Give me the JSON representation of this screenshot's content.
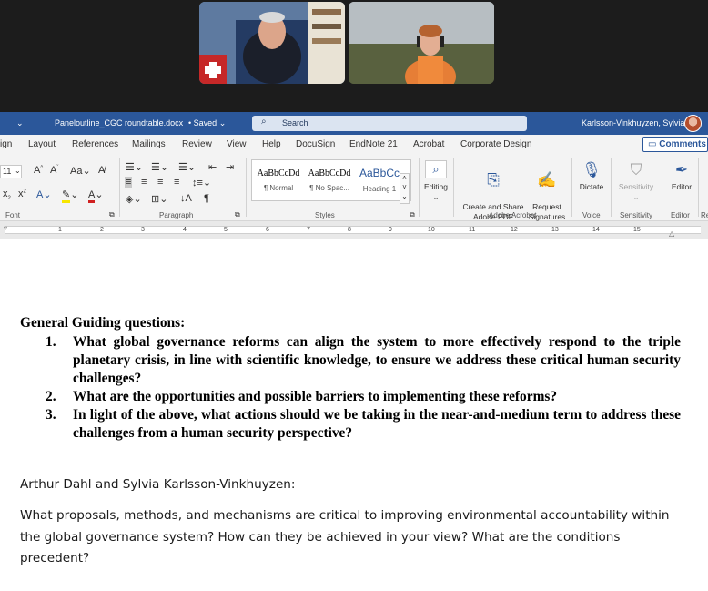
{
  "titlebar": {
    "quick_access_chevron": "⌄",
    "filename": "Paneloutline_CGC roundtable.docx",
    "save_status": "Saved",
    "search_placeholder": "Search",
    "user_name": "Karlsson-Vinkhuyzen, Sylvia"
  },
  "tabs": [
    "ign",
    "Layout",
    "References",
    "Mailings",
    "Review",
    "View",
    "Help",
    "DocuSign",
    "EndNote 21",
    "Acrobat",
    "Corporate Design"
  ],
  "comments_label": "Comments",
  "ribbon": {
    "font_size": "11",
    "font_group": "Font",
    "paragraph_group": "Paragraph",
    "styles_group": "Styles",
    "styles": [
      {
        "sample": "AaBbCcDd",
        "name": "¶ Normal"
      },
      {
        "sample": "AaBbCcDd",
        "name": "¶ No Spac..."
      },
      {
        "sample": "AaBbCc",
        "name": "Heading 1"
      }
    ],
    "editing": "Editing",
    "create_share": "Create and Share\nAdobe PDF",
    "request_signatures": "Request\nSignatures",
    "adobe_acrobat_group": "Adobe Acrobat",
    "dictate": "Dictate",
    "voice_group": "Voice",
    "sensitivity": "Sensitivity",
    "sensitivity_group": "Sensitivity",
    "editor": "Editor",
    "editor_group": "Editor",
    "cut_group": "Re"
  },
  "ruler_numbers": [
    "1",
    "2",
    "3",
    "4",
    "5",
    "6",
    "7",
    "8",
    "9",
    "10",
    "11",
    "12",
    "13",
    "14",
    "15"
  ],
  "document": {
    "heading": "General Guiding questions:",
    "questions": [
      {
        "num": "1.",
        "text": "What global governance reforms can align the system to more effectively respond to the triple planetary crisis, in line with scientific knowledge, to ensure we address these critical human security challenges?"
      },
      {
        "num": "2.",
        "text": "What are the opportunities and possible barriers to implementing these reforms?"
      },
      {
        "num": "3.",
        "text": "In light of the above, what actions should we be taking in the near-and-medium term to address these challenges from a human security perspective?"
      }
    ],
    "authors": "Arthur Dahl and Sylvia Karlsson-Vinkhuyzen:",
    "paragraph": "What proposals, methods, and mechanisms are critical to improving environmental accountability within the global governance system? How can they be achieved in your view? What are the conditions precedent?"
  }
}
